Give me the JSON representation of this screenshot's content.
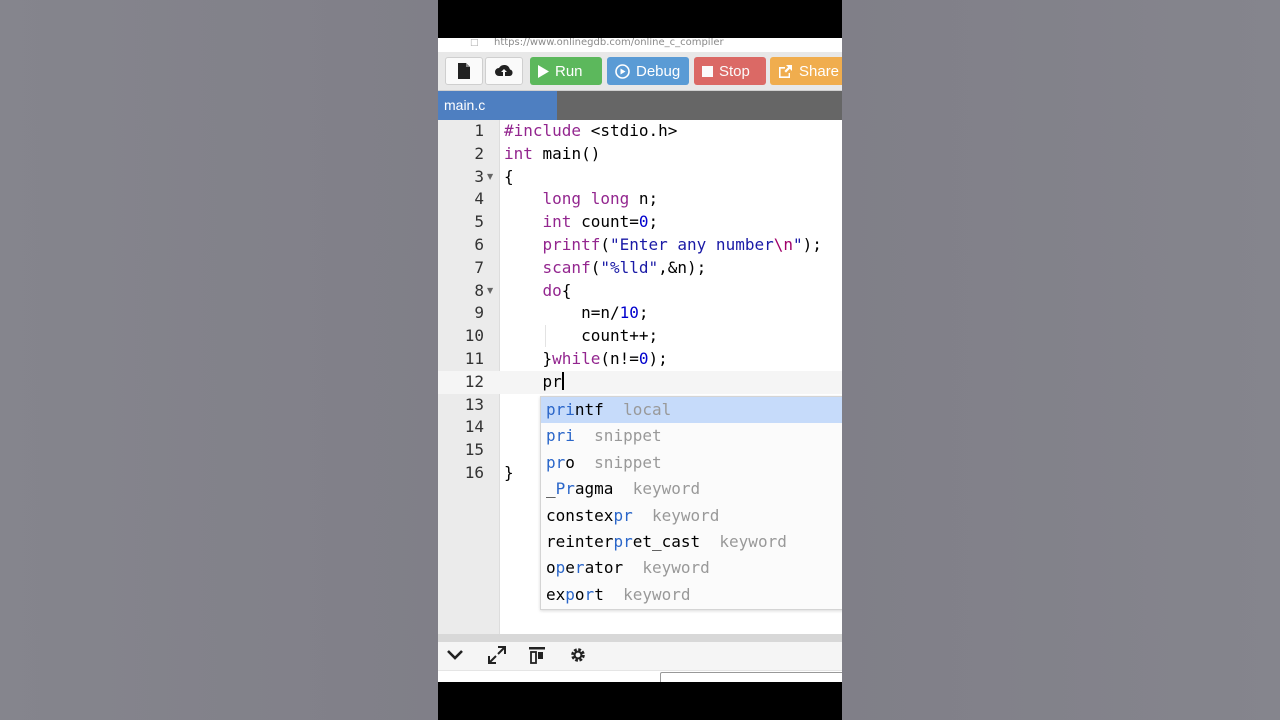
{
  "browser": {
    "url": "https://www.onlinegdb.com/online_c_compiler"
  },
  "toolbar": {
    "new_file_icon": "file-icon",
    "upload_icon": "cloud-upload-icon",
    "run_label": "Run",
    "debug_label": "Debug",
    "stop_label": "Stop",
    "share_label": "Share"
  },
  "tabs": [
    {
      "label": "main.c",
      "active": true
    }
  ],
  "editor": {
    "line_numbers": [
      "1",
      "2",
      "3",
      "4",
      "5",
      "6",
      "7",
      "8",
      "9",
      "10",
      "11",
      "12",
      "13",
      "14",
      "15",
      "16"
    ],
    "current_line": "12",
    "typed_text": "pr"
  },
  "autocomplete": {
    "items": [
      {
        "pre": "",
        "match": "pri",
        "post": "ntf",
        "meta": "local",
        "selected": true
      },
      {
        "pre": "",
        "match": "pri",
        "post": "",
        "meta": "snippet"
      },
      {
        "pre": "",
        "match": "pr",
        "post": "o",
        "meta": "snippet"
      },
      {
        "pre": "_",
        "match": "Pr",
        "post": "agma",
        "meta": "keyword"
      },
      {
        "pre": "constex",
        "match": "pr",
        "post": "",
        "meta": "keyword"
      },
      {
        "pre": "reinter",
        "match": "pr",
        "post": "et_cast",
        "meta": "keyword"
      },
      {
        "pre": "o",
        "match": "p",
        "post": "e",
        "meta": "keyword",
        "post2": "r",
        "post3": "ator"
      },
      {
        "pre": "ex",
        "match": "p",
        "post": "o",
        "meta": "keyword",
        "post2": "r",
        "post3": "t"
      }
    ]
  },
  "bottom": {
    "icons": [
      "chevron-down-icon",
      "expand-icon",
      "layout-icon",
      "gear-icon"
    ]
  },
  "colors": {
    "run": "#5cb85c",
    "debug": "#5a9bd5",
    "stop": "#d9534f",
    "share": "#f0ad4e",
    "tab_active": "#4e7fc1",
    "keyword": "#93268f",
    "string": "#1a1aa6",
    "number": "#0000cd"
  }
}
